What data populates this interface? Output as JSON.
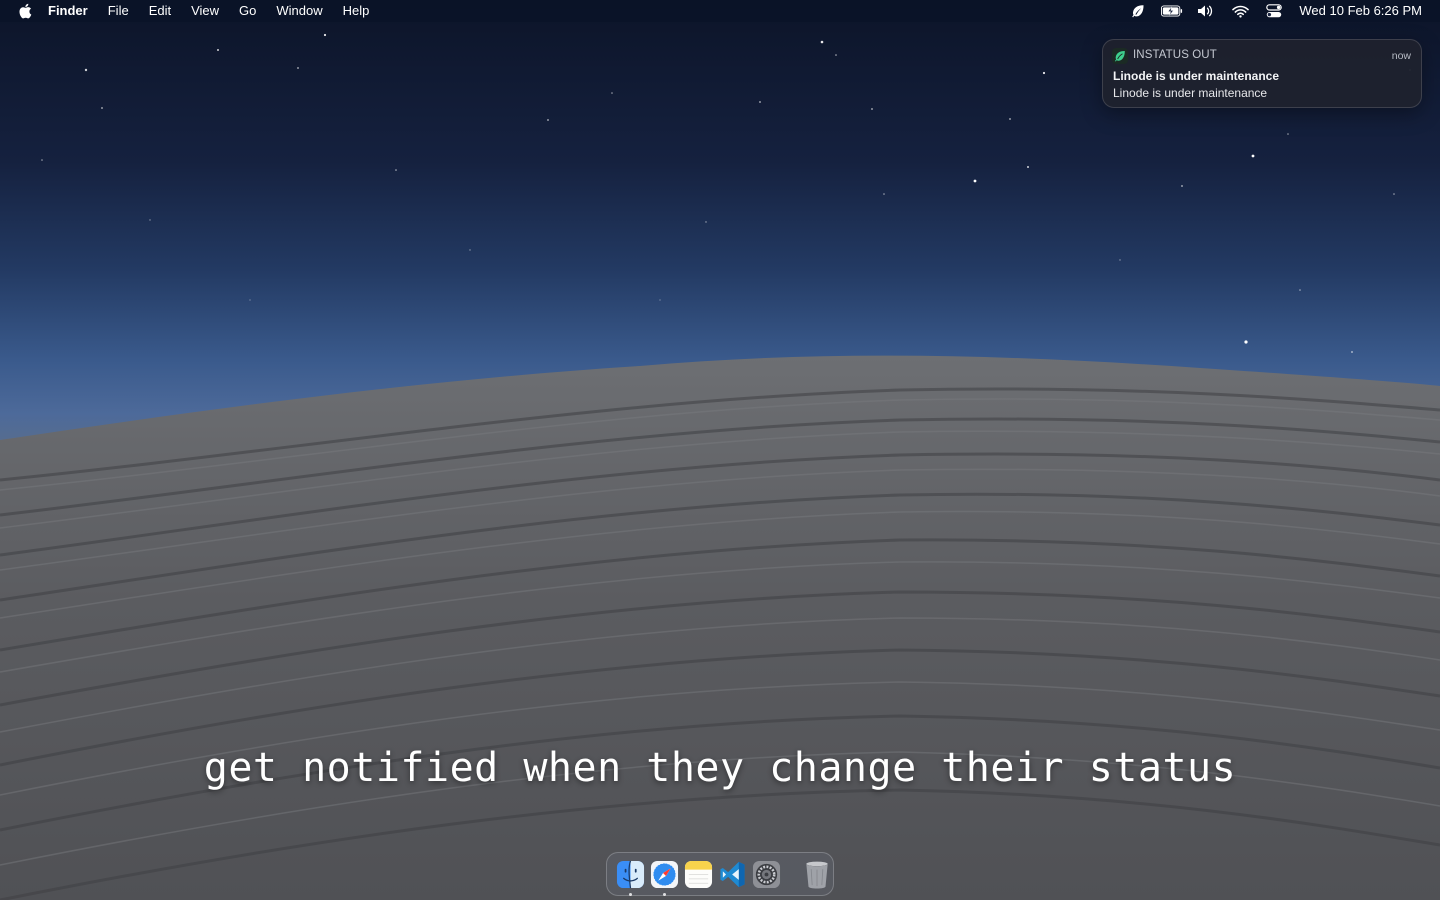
{
  "menubar": {
    "apple_icon": "apple-logo-icon",
    "app_name": "Finder",
    "menus": [
      "File",
      "Edit",
      "View",
      "Go",
      "Window",
      "Help"
    ],
    "status_icons": [
      "leaf-icon",
      "battery-charging-icon",
      "volume-icon",
      "wifi-icon",
      "control-center-icon"
    ],
    "clock": "Wed 10 Feb  6:26 PM"
  },
  "notification": {
    "app_icon": "instatus-leaf-icon",
    "app_name": "INSTATUS OUT",
    "time": "now",
    "title": "Linode is under maintenance",
    "body": "Linode is under maintenance"
  },
  "caption": "get notified when they change their status",
  "dock": {
    "apps": [
      {
        "name": "Finder",
        "icon": "finder-icon",
        "running": true
      },
      {
        "name": "Safari",
        "icon": "safari-icon",
        "running": true
      },
      {
        "name": "Notes",
        "icon": "notes-icon",
        "running": false
      },
      {
        "name": "Visual Studio Code",
        "icon": "vscode-icon",
        "running": false
      },
      {
        "name": "System Preferences",
        "icon": "system-preferences-icon",
        "running": false
      }
    ],
    "trash": {
      "name": "Trash",
      "icon": "trash-icon"
    }
  },
  "colors": {
    "accent_green": "#3ecf8e",
    "menubar_bg": "#0a1226",
    "notification_bg": "#1e222e"
  }
}
